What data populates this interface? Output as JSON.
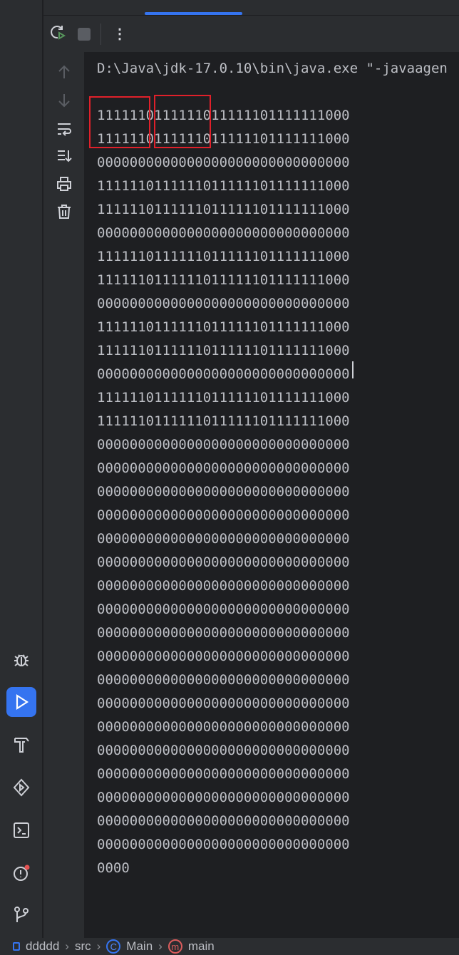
{
  "console": {
    "command": "D:\\Java\\jdk-17.0.10\\bin\\java.exe \"-javaagen",
    "lines": [
      "1111110111111011111101111111000",
      "1111110111111011111101111111000",
      "0000000000000000000000000000000",
      "1111110111111011111101111111000",
      "1111110111111011111101111111000",
      "0000000000000000000000000000000",
      "1111110111111011111101111111000",
      "1111110111111011111101111111000",
      "0000000000000000000000000000000",
      "1111110111111011111101111111000",
      "1111110111111011111101111111000",
      "0000000000000000000000000000000",
      "1111110111111011111101111111000",
      "1111110111111011111101111111000",
      "0000000000000000000000000000000",
      "0000000000000000000000000000000",
      "0000000000000000000000000000000",
      "0000000000000000000000000000000",
      "0000000000000000000000000000000",
      "0000000000000000000000000000000",
      "0000000000000000000000000000000",
      "0000000000000000000000000000000",
      "0000000000000000000000000000000",
      "0000000000000000000000000000000",
      "0000000000000000000000000000000",
      "0000000000000000000000000000000",
      "0000000000000000000000000000000",
      "0000000000000000000000000000000",
      "0000000000000000000000000000000",
      "0000000000000000000000000000000",
      "0000000000000000000000000000000",
      "0000000000000000000000000000000",
      "0000"
    ]
  },
  "breadcrumb": {
    "project": "ddddd",
    "folder": "src",
    "class": "Main",
    "method": "main"
  },
  "colors": {
    "accent": "#3574f0",
    "highlight": "#e0202a"
  }
}
